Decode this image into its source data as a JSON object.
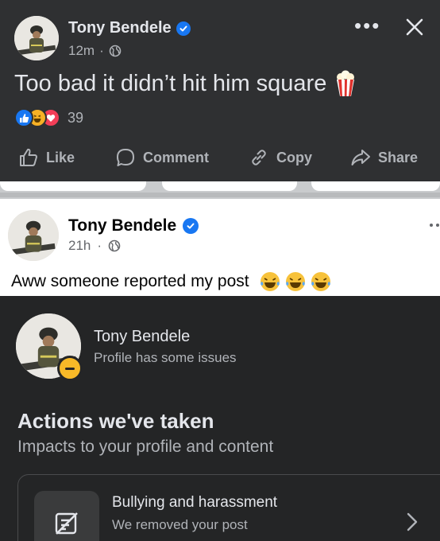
{
  "top_post": {
    "author": "Tony Bendele",
    "time": "12m",
    "separator": "·",
    "more_label": "•••",
    "text": "Too bad it didn’t hit him square",
    "reaction_count": "39",
    "actions": {
      "like": "Like",
      "comment": "Comment",
      "copy": "Copy",
      "share": "Share"
    }
  },
  "second_post": {
    "author": "Tony Bendele",
    "time": "21h",
    "separator": "·",
    "text": "Aww someone reported my post"
  },
  "status_panel": {
    "profile_name": "Tony Bendele",
    "profile_status": "Profile has some issues",
    "heading": "Actions we've taken",
    "subheading": "Impacts to your profile and content",
    "item": {
      "title": "Bullying and harassment",
      "description": "We removed your post"
    }
  },
  "colors": {
    "brand_blue": "#1877f2",
    "warning_yellow": "#f7b928",
    "love_red": "#f33e58"
  }
}
